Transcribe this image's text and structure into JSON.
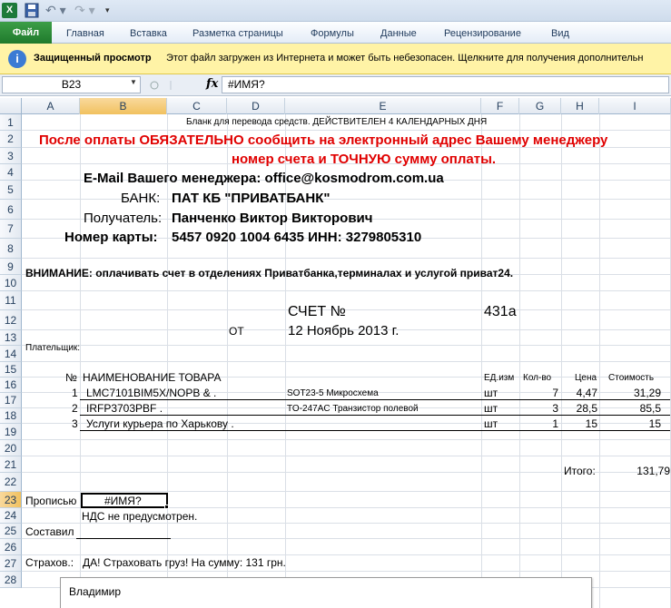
{
  "qat": {
    "app_icon": "X"
  },
  "ribbon": {
    "tabs": [
      "Файл",
      "Главная",
      "Вставка",
      "Разметка страницы",
      "Формулы",
      "Данные",
      "Рецензирование",
      "Вид"
    ]
  },
  "protected_view": {
    "title": "Защищенный просмотр",
    "message": "Этот файл загружен из Интернета и может быть небезопасен. Щелкните для получения дополнительн"
  },
  "formula_bar": {
    "name_box": "B23",
    "fx": "fx",
    "formula": "#ИМЯ?"
  },
  "columns": [
    "A",
    "B",
    "C",
    "D",
    "E",
    "F",
    "G",
    "H",
    "I"
  ],
  "rows": [
    "1",
    "2",
    "3",
    "4",
    "5",
    "6",
    "7",
    "8",
    "9",
    "10",
    "11",
    "12",
    "13",
    "14",
    "15",
    "16",
    "17",
    "18",
    "19",
    "20",
    "21",
    "22",
    "23",
    "24",
    "25",
    "26",
    "27",
    "28"
  ],
  "sheet": {
    "r1": "Бланк для перевода средств. ДЕЙСТВИТЕЛЕН 4 КАЛЕНДАРНЫХ ДНЯ",
    "r2": "После оплаты ОБЯЗАТЕЛЬНО сообщить на электронный адрес Вашему менеджеру",
    "r3": "номер счета и ТОЧНУЮ сумму оплаты.",
    "r4": "E-Mail Вашего менеджера: office@kosmodrom.com.ua",
    "bank_label": "БАНК:",
    "bank_value": "ПАТ КБ \"ПРИВАТБАНК\"",
    "recipient_label": "Получатель:",
    "recipient_value": "Панченко Виктор Викторович",
    "card_label": "Номер карты:",
    "card_value": "5457 0920 1004 6435   ИНН: 3279805310",
    "r9_bold": "ВНИМАНИЕ:",
    "r9_rest": " оплачивать счет в отделениях Приватбанка,терминалах и услугой приват24.",
    "invoice_label": "СЧЕТ №",
    "invoice_no": "431а",
    "from_label": "ОТ",
    "date": "12 Ноябрь 2013 г.",
    "payer_label": "Плательщик:",
    "hdr_no": "№",
    "hdr_name": "НАИМЕНОВАНИЕ ТОВАРА",
    "hdr_unit": "ЕД.изм",
    "hdr_qty": "Кол-во",
    "hdr_price": "Цена",
    "hdr_cost": "Стоимость",
    "items": [
      {
        "no": "1",
        "name": "LMC7101BIM5X/NOPB  & .",
        "desc": "SOT23-5 Микросхема",
        "unit": "шт",
        "qty": "7",
        "price": "4,47",
        "cost": "31,29"
      },
      {
        "no": "2",
        "name": "IRFP3703PBF .",
        "desc": "TO-247AC Транзистор полевой",
        "unit": "шт",
        "qty": "3",
        "price": "28,5",
        "cost": "85,5"
      },
      {
        "no": "3",
        "name": "Услуги курьера по Харькову .",
        "desc": "",
        "unit": "шт",
        "qty": "1",
        "price": "15",
        "cost": "15"
      }
    ],
    "total_label": "Итого:",
    "total_value": "131,79",
    "words_label": "Прописью",
    "words_value": "#ИМЯ?",
    "vat": "НДС не предусмотрен.",
    "compiled_label": "Составил",
    "insurance_label": "Страхов.:",
    "insurance_value": "ДА! Страховать груз! На сумму:   131 грн."
  },
  "comment": {
    "text": "Владимир"
  }
}
